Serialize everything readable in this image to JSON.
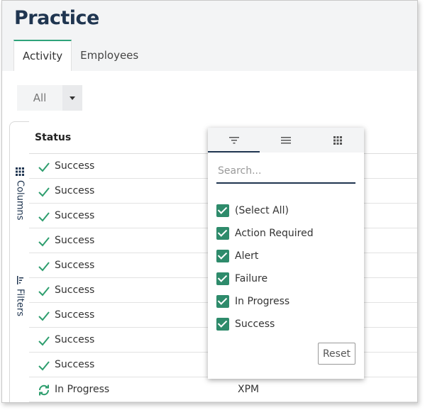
{
  "page": {
    "title": "Practice"
  },
  "tabs": [
    {
      "label": "Activity",
      "active": true
    },
    {
      "label": "Employees",
      "active": false
    }
  ],
  "filter_select": {
    "value": "All",
    "icon": "caret-down-icon"
  },
  "side_panel": {
    "columns_label": "Columns",
    "columns_icon": "grid-icon",
    "filters_label": "Filters",
    "filters_icon": "filter-icon"
  },
  "grid": {
    "columns": [
      "Status"
    ],
    "rows": [
      {
        "status": "Success",
        "icon": "check-icon",
        "extra": ""
      },
      {
        "status": "Success",
        "icon": "check-icon",
        "extra": ""
      },
      {
        "status": "Success",
        "icon": "check-icon",
        "extra": ""
      },
      {
        "status": "Success",
        "icon": "check-icon",
        "extra": ""
      },
      {
        "status": "Success",
        "icon": "check-icon",
        "extra": ""
      },
      {
        "status": "Success",
        "icon": "check-icon",
        "extra": ""
      },
      {
        "status": "Success",
        "icon": "check-icon",
        "extra": ""
      },
      {
        "status": "Success",
        "icon": "check-icon",
        "extra": ""
      },
      {
        "status": "Success",
        "icon": "check-icon",
        "extra": ""
      },
      {
        "status": "In Progress",
        "icon": "sync-icon",
        "extra": "XPM"
      }
    ]
  },
  "filter_popup": {
    "tabs": [
      {
        "icon": "filter-icon",
        "active": true
      },
      {
        "icon": "menu-icon",
        "active": false
      },
      {
        "icon": "grid-icon",
        "active": false
      }
    ],
    "search_placeholder": "Search...",
    "options": [
      {
        "label": "(Select All)",
        "checked": true
      },
      {
        "label": "Action Required",
        "checked": true
      },
      {
        "label": "Alert",
        "checked": true
      },
      {
        "label": "Failure",
        "checked": true
      },
      {
        "label": "In Progress",
        "checked": true
      },
      {
        "label": "Success",
        "checked": true
      }
    ],
    "reset_label": "Reset"
  },
  "colors": {
    "accent": "#2e8b6b",
    "title": "#1f3550",
    "check": "#2e9e6e"
  }
}
